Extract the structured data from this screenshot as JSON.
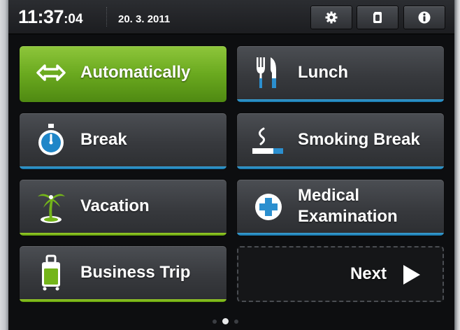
{
  "status": {
    "time_hm": "11:37",
    "time_sec": ":04",
    "date": "20. 3. 2011"
  },
  "toolbar": {
    "settings_icon": "gear-icon",
    "card_icon": "card-icon",
    "info_icon": "info-icon"
  },
  "tiles": [
    {
      "label": "Automatically",
      "icon": "swap-arrows-icon",
      "state": "active"
    },
    {
      "label": "Lunch",
      "icon": "fork-knife-icon",
      "accent": "#1b7fb8"
    },
    {
      "label": "Break",
      "icon": "stopwatch-icon",
      "accent": "#1b7fb8"
    },
    {
      "label": "Smoking Break",
      "icon": "cigarette-icon",
      "accent": "#1b7fb8"
    },
    {
      "label": "Vacation",
      "icon": "palm-tree-icon",
      "accent": "#74b51a"
    },
    {
      "label": "Medical Examination",
      "icon": "medical-cross-icon",
      "accent": "#1b7fb8"
    },
    {
      "label": "Business Trip",
      "icon": "suitcase-icon",
      "accent": "#74b51a"
    }
  ],
  "next": {
    "label": "Next",
    "icon": "play-arrow-icon"
  },
  "pager": {
    "pages": 3,
    "current": 2
  },
  "colors": {
    "green": "#74b51a",
    "blue": "#1b7fb8",
    "background": "#0d0e10"
  }
}
